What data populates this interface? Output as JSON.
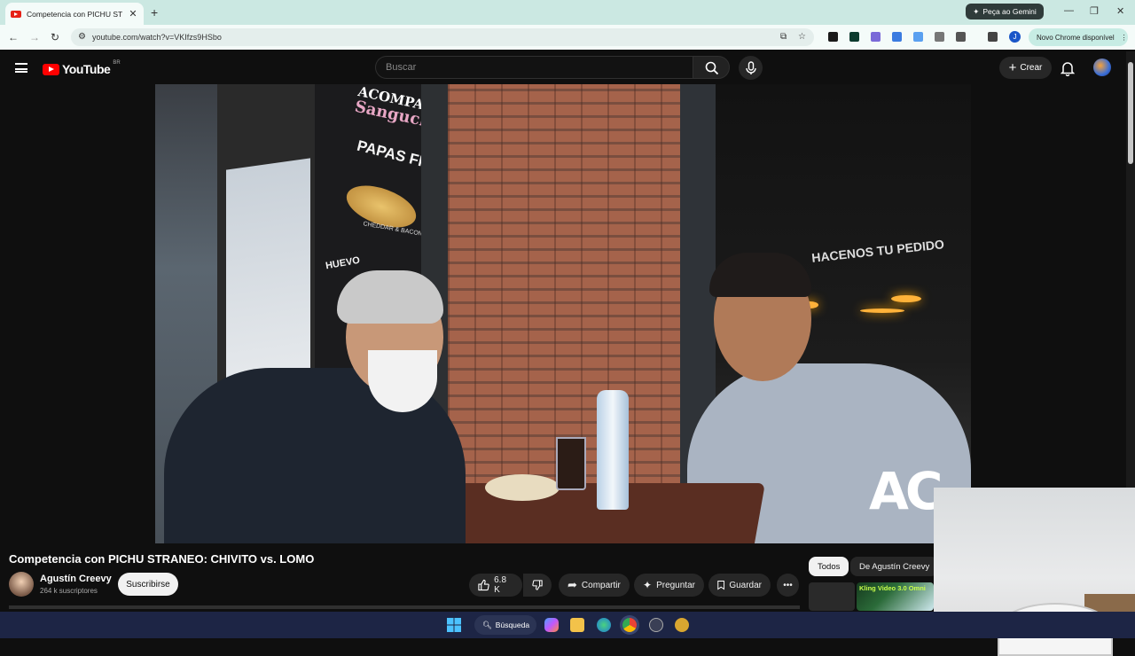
{
  "browser": {
    "tab_title": "Competencia con PICHU STRAI",
    "new_tab": "+",
    "gemini_button": "Peça ao Gemini",
    "url": "youtube.com/watch?v=VKIfzs9HSbo",
    "update_button": "Novo Chrome disponível",
    "profile_letter": "J"
  },
  "youtube": {
    "logo_text": "YouTube",
    "country_code": "BR",
    "search_placeholder": "Buscar",
    "create_label": "Crear"
  },
  "video": {
    "title": "Competencia con PICHU STRANEO: CHIVITO vs. LOMO",
    "channel_name": "Agustín Creevy",
    "subscribers": "264 k suscriptores",
    "subscribe_label": "Suscribirse",
    "likes": "6.8 K",
    "share_label": "Compartir",
    "ask_label": "Preguntar",
    "save_label": "Guardar",
    "scene_text": {
      "sign_top": "ACOMPAÑÁ",
      "sign_pink": "Sanguches",
      "sign_papas": "PAPAS FRITAS",
      "sign_cheddar": "CHEDDAR & BACON",
      "sign_huevo": "HUEVO",
      "sign_right": "HACENOS TU PEDIDO",
      "watermark": "AC"
    }
  },
  "sidebar": {
    "filters": [
      "Todos",
      "De Agustín Creevy"
    ],
    "kling_label": "Kling Video 3.0 Omni"
  },
  "taskbar": {
    "search_label": "Búsqueda"
  }
}
